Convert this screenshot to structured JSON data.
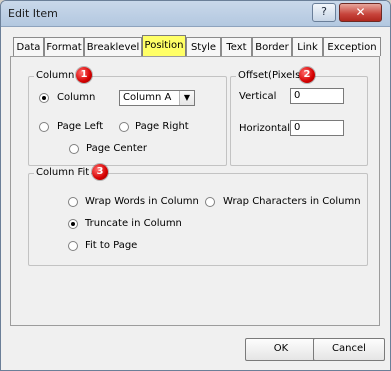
{
  "window": {
    "title": "Edit Item"
  },
  "titlebar": {
    "help_label": "?",
    "close_label": "✕"
  },
  "tabs": [
    {
      "label": "Data",
      "active": false
    },
    {
      "label": "Format",
      "active": false
    },
    {
      "label": "Breaklevel",
      "active": false
    },
    {
      "label": "Position",
      "active": true
    },
    {
      "label": "Style",
      "active": false
    },
    {
      "label": "Text",
      "active": false
    },
    {
      "label": "Border",
      "active": false
    },
    {
      "label": "Link",
      "active": false
    },
    {
      "label": "Exception",
      "active": false
    }
  ],
  "column_group": {
    "legend": "Column",
    "badge": "1",
    "options": {
      "column": "Column",
      "page_left": "Page Left",
      "page_right": "Page Right",
      "page_center": "Page Center"
    },
    "selected": "column",
    "column_select_value": "Column A"
  },
  "offset_group": {
    "legend": "Offset(Pixels)",
    "badge": "2",
    "vertical_label": "Vertical",
    "vertical_value": "0",
    "horizontal_label": "Horizontal",
    "horizontal_value": "0"
  },
  "column_fit_group": {
    "legend": "Column Fit",
    "badge": "3",
    "options": {
      "wrap_words": "Wrap Words in Column",
      "wrap_chars": "Wrap Characters in Column",
      "truncate": "Truncate in Column",
      "fit_page": "Fit to Page"
    },
    "selected": "truncate"
  },
  "buttons": {
    "ok": "OK",
    "cancel": "Cancel"
  },
  "icons": {
    "badge_color": "#d50000",
    "active_tab_color": "#ffff66"
  }
}
